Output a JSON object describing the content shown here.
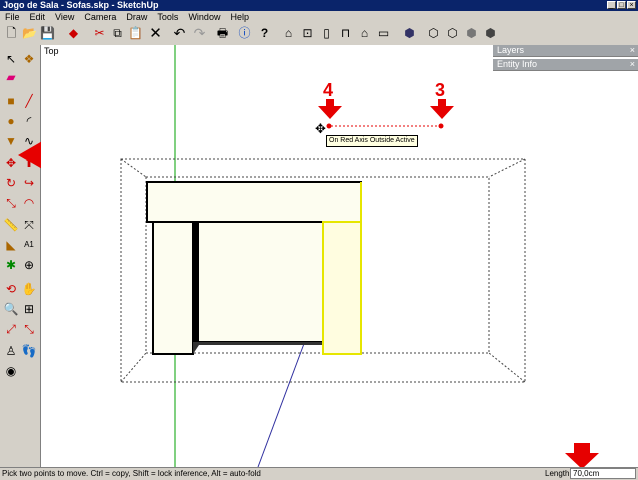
{
  "window": {
    "title": "Jogo de Sala - Sofas.skp - SketchUp",
    "buttons": [
      "_",
      "□",
      "×"
    ]
  },
  "menu": [
    "File",
    "Edit",
    "View",
    "Camera",
    "Draw",
    "Tools",
    "Window",
    "Help"
  ],
  "toolbar_icons": [
    "new-icon",
    "open-icon",
    "save-icon",
    "model-info-icon",
    "cut-icon",
    "copy-icon",
    "paste-icon",
    "erase-icon",
    "undo-icon",
    "redo-icon",
    "print-icon",
    "info-icon",
    "help-icon",
    "iso-view-icon",
    "top-view-icon",
    "front-view-icon",
    "right-view-icon",
    "back-view-icon",
    "left-view-icon",
    "xray-icon",
    "wireframe-icon",
    "hidden-line-icon",
    "shaded-icon",
    "textured-icon"
  ],
  "viewport": {
    "view_label": "Top"
  },
  "panels": {
    "layers": "Layers",
    "entity_info": "Entity Info"
  },
  "tooltip": "On Red Axis Outside Active",
  "annotations": {
    "point_a": "4",
    "point_b": "3"
  },
  "status": {
    "message": "Pick two points to move.  Ctrl = copy, Shift = lock inference, Alt = auto-fold",
    "length_label": "Length",
    "length_value": "70,0cm"
  },
  "colors": {
    "accent_red": "#e60000",
    "selection_yellow": "#ffff00",
    "sofa_fill": "#fdfdf0",
    "green_axis": "#00a000",
    "blue_axis": "#3030a0"
  }
}
